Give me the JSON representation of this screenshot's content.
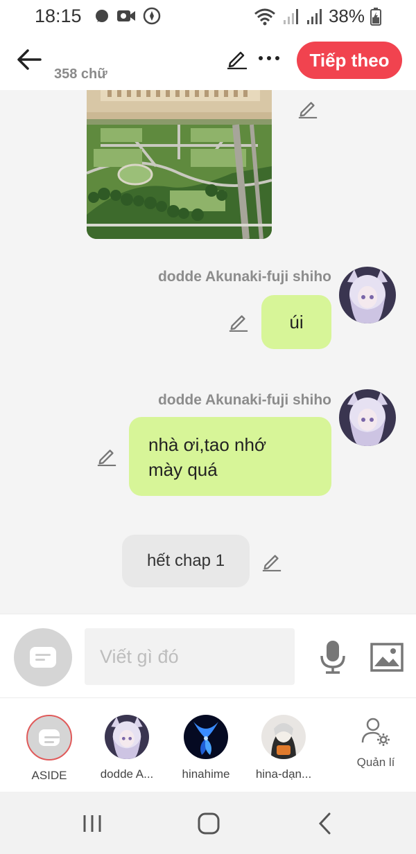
{
  "status_bar": {
    "time": "18:15",
    "battery": "38%",
    "icons": [
      "chat-bubble-icon",
      "video-camera-icon",
      "compass-icon",
      "wifi-icon",
      "signal-icon",
      "signal-icon",
      "battery-icon"
    ]
  },
  "header": {
    "word_count": "358 chữ",
    "next_label": "Tiếp theo",
    "accent_color": "#f1434f"
  },
  "chat": {
    "messages": [
      {
        "type": "image",
        "subject": "palace-aerial-photo"
      },
      {
        "sender": "dodde Akunaki-fuji shiho",
        "text": "úi"
      },
      {
        "sender": "dodde Akunaki-fuji shiho",
        "text_lines": [
          "nhà ơi,tao nhớ",
          "mày quá"
        ]
      },
      {
        "type": "aside",
        "text": "hết chap 1"
      }
    ],
    "bubble_color": "#d7f598"
  },
  "compose": {
    "placeholder": "Viết gì đó"
  },
  "characters": [
    {
      "name": "ASIDE",
      "selected": true
    },
    {
      "name": "dodde A..."
    },
    {
      "name": "hinahime"
    },
    {
      "name": "hina-dạn..."
    }
  ],
  "manage_label": "Quản lí"
}
